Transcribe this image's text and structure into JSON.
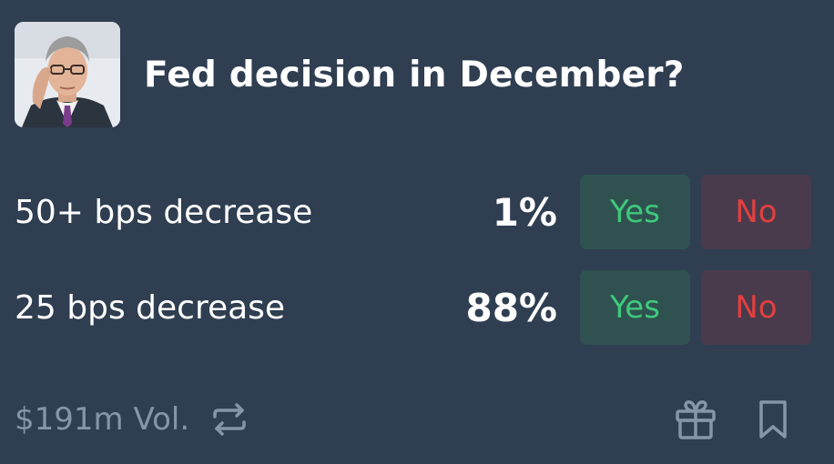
{
  "market": {
    "title": "Fed decision in December?",
    "avatar_icon": "portrait-avatar"
  },
  "outcomes": [
    {
      "label": "50+ bps decrease",
      "probability": "1%",
      "yes_label": "Yes",
      "no_label": "No"
    },
    {
      "label": "25 bps decrease",
      "probability": "88%",
      "yes_label": "Yes",
      "no_label": "No"
    }
  ],
  "footer": {
    "volume": "$191m Vol.",
    "icons": [
      "repeat-icon",
      "gift-icon",
      "bookmark-icon"
    ]
  },
  "colors": {
    "background": "#2f3e51",
    "yes_bg": "#2f5250",
    "yes_text": "#3ec97c",
    "no_bg": "#493b4c",
    "no_text": "#e1403f",
    "muted_text": "#8695a8"
  }
}
